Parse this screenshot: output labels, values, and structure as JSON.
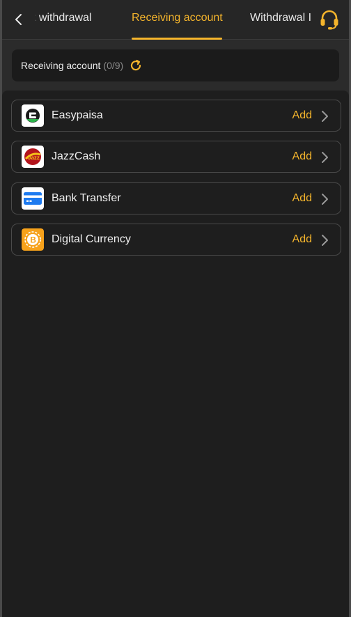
{
  "header": {
    "tabs": [
      {
        "label": "t withdrawal"
      },
      {
        "label": "Receiving account"
      },
      {
        "label": "Withdrawal I"
      }
    ],
    "active_tab": 1,
    "accent_color": "#f5b52c"
  },
  "account_bar": {
    "label": "Receiving account",
    "count": "(0/9)"
  },
  "methods": [
    {
      "name": "Easypaisa",
      "action": "Add",
      "icon": "easypaisa-logo"
    },
    {
      "name": "JazzCash",
      "action": "Add",
      "icon": "jazzcash-logo"
    },
    {
      "name": "Bank Transfer",
      "action": "Add",
      "icon": "bank-card-icon"
    },
    {
      "name": "Digital Currency",
      "action": "Add",
      "icon": "bitcoin-coin-icon"
    }
  ]
}
